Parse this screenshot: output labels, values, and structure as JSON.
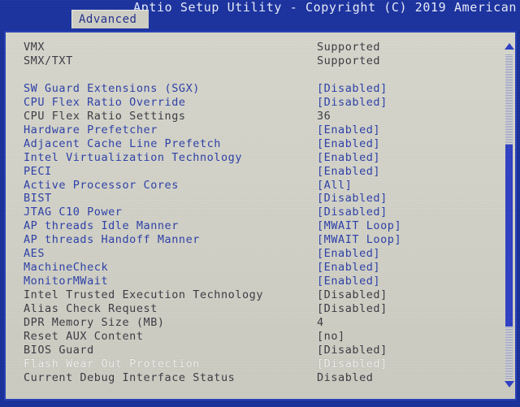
{
  "header": {
    "title": "Aptio Setup Utility - Copyright (C) 2019 American",
    "active_tab": "Advanced"
  },
  "colors": {
    "header_bg": "#1b32a0",
    "panel_bg": "#d3d3c9",
    "panel_border": "#2740b4",
    "tab_bg": "#cfcfc6",
    "tab_text": "#24308c",
    "setting_blue": "#2c3fa8",
    "readonly_gray": "#3b3b44",
    "highlight_white": "#f2f2ee",
    "scrollbar_thumb": "#2f3fc4"
  },
  "settings": [
    {
      "label": "VMX",
      "value": "Supported",
      "state": "readonly",
      "interactable": false
    },
    {
      "label": "SMX/TXT",
      "value": "Supported",
      "state": "readonly",
      "interactable": false
    },
    {
      "label": "",
      "value": "",
      "state": "spacer",
      "interactable": false
    },
    {
      "label": "SW Guard Extensions (SGX)",
      "value": "[Disabled]",
      "state": "setting",
      "interactable": true
    },
    {
      "label": "CPU Flex Ratio Override",
      "value": "[Disabled]",
      "state": "setting",
      "interactable": true
    },
    {
      "label": "CPU Flex Ratio Settings",
      "value": "36",
      "state": "readonly",
      "interactable": false
    },
    {
      "label": "Hardware Prefetcher",
      "value": "[Enabled]",
      "state": "setting",
      "interactable": true
    },
    {
      "label": "Adjacent Cache Line Prefetch",
      "value": "[Enabled]",
      "state": "setting",
      "interactable": true
    },
    {
      "label": "Intel Virtualization Technology",
      "value": "[Enabled]",
      "state": "setting",
      "interactable": true
    },
    {
      "label": "PECI",
      "value": "[Enabled]",
      "state": "setting",
      "interactable": true
    },
    {
      "label": "Active Processor Cores",
      "value": "[All]",
      "state": "setting",
      "interactable": true
    },
    {
      "label": "BIST",
      "value": "[Disabled]",
      "state": "setting",
      "interactable": true
    },
    {
      "label": "JTAG C10 Power",
      "value": "[Disabled]",
      "state": "setting",
      "interactable": true
    },
    {
      "label": "AP threads Idle Manner",
      "value": "[MWAIT Loop]",
      "state": "setting",
      "interactable": true
    },
    {
      "label": "AP threads Handoff Manner",
      "value": "[MWAIT Loop]",
      "state": "setting",
      "interactable": true
    },
    {
      "label": "AES",
      "value": "[Enabled]",
      "state": "setting",
      "interactable": true
    },
    {
      "label": "MachineCheck",
      "value": "[Enabled]",
      "state": "setting",
      "interactable": true
    },
    {
      "label": "MonitorMWait",
      "value": "[Enabled]",
      "state": "setting",
      "interactable": true
    },
    {
      "label": "Intel Trusted Execution Technology",
      "value": "[Disabled]",
      "state": "readonly",
      "interactable": true
    },
    {
      "label": "Alias Check Request",
      "value": "[Disabled]",
      "state": "readonly",
      "interactable": true
    },
    {
      "label": "DPR Memory Size (MB)",
      "value": "4",
      "state": "readonly",
      "interactable": false
    },
    {
      "label": "Reset AUX Content",
      "value": "[no]",
      "state": "readonly",
      "interactable": true
    },
    {
      "label": "BIOS Guard",
      "value": "[Disabled]",
      "state": "readonly",
      "interactable": true
    },
    {
      "label": "Flash Wear Out Protection",
      "value": "[Disabled]",
      "state": "highlight",
      "interactable": true
    },
    {
      "label": "Current Debug Interface Status",
      "value": "Disabled",
      "state": "readonly",
      "interactable": false
    }
  ],
  "scrollbar": {
    "up_arrow": "scroll-up-arrow",
    "down_arrow": "scroll-down-arrow",
    "thumb_top_pct": 28,
    "thumb_height_pct": 56
  }
}
